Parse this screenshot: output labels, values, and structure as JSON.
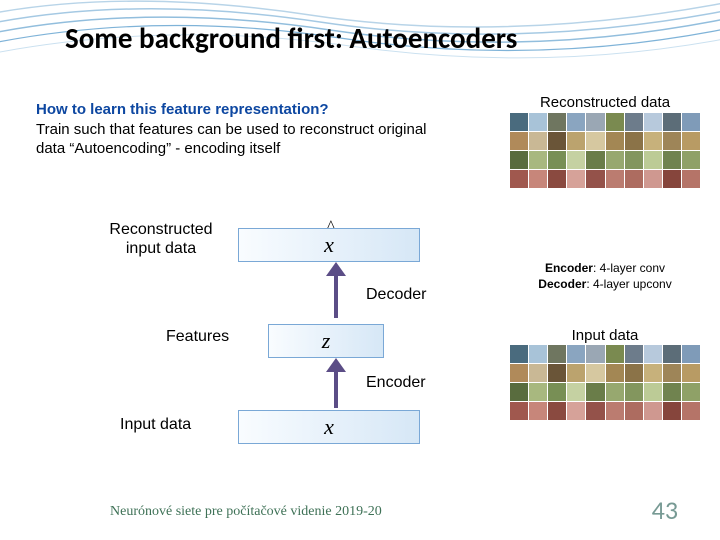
{
  "title": "Some background first: Autoencoders",
  "intro": {
    "question": "How to learn this feature representation?",
    "answer": "Train such that features can be used to reconstruct original data  “Autoencoding” - encoding itself"
  },
  "right": {
    "reconstructed_title": "Reconstructed data",
    "encoder_caption_bold": "Encoder",
    "encoder_caption_rest": ": 4-layer conv",
    "decoder_caption_bold": "Decoder",
    "decoder_caption_rest": ": 4-layer upconv",
    "input_data": "Input data"
  },
  "diagram": {
    "recon_label": "Reconstructed input data",
    "xhat": "x",
    "features_label": "Features",
    "z": "z",
    "input_label": "Input data",
    "x": "x",
    "decoder": "Decoder",
    "encoder": "Encoder"
  },
  "footer": "Neurónové siete pre počítačové videnie 2019-20",
  "slide_number": "43",
  "grid_colors": [
    "#4a6b7e",
    "#a8c3d8",
    "#6f7660",
    "#8aa5c0",
    "#9aa7b4",
    "#7a8a50",
    "#6d7c8b",
    "#b7c9dc",
    "#5c6d78",
    "#7f9bb8",
    "#b08a5a",
    "#c9b895",
    "#6a5538",
    "#bba36e",
    "#d6c8a0",
    "#a38754",
    "#8b7348",
    "#c7b17b",
    "#9e8558",
    "#b89b64",
    "#596c3e",
    "#a8b87f",
    "#788f55",
    "#c5d1a2",
    "#6a7d49",
    "#97a86f",
    "#83965e",
    "#bccb96",
    "#70834f",
    "#8fa167",
    "#a0584e",
    "#c7867a",
    "#8a4a40",
    "#d6a299",
    "#94524a",
    "#bb7c70",
    "#ad6c60",
    "#cf9890",
    "#86453c",
    "#b57468"
  ]
}
